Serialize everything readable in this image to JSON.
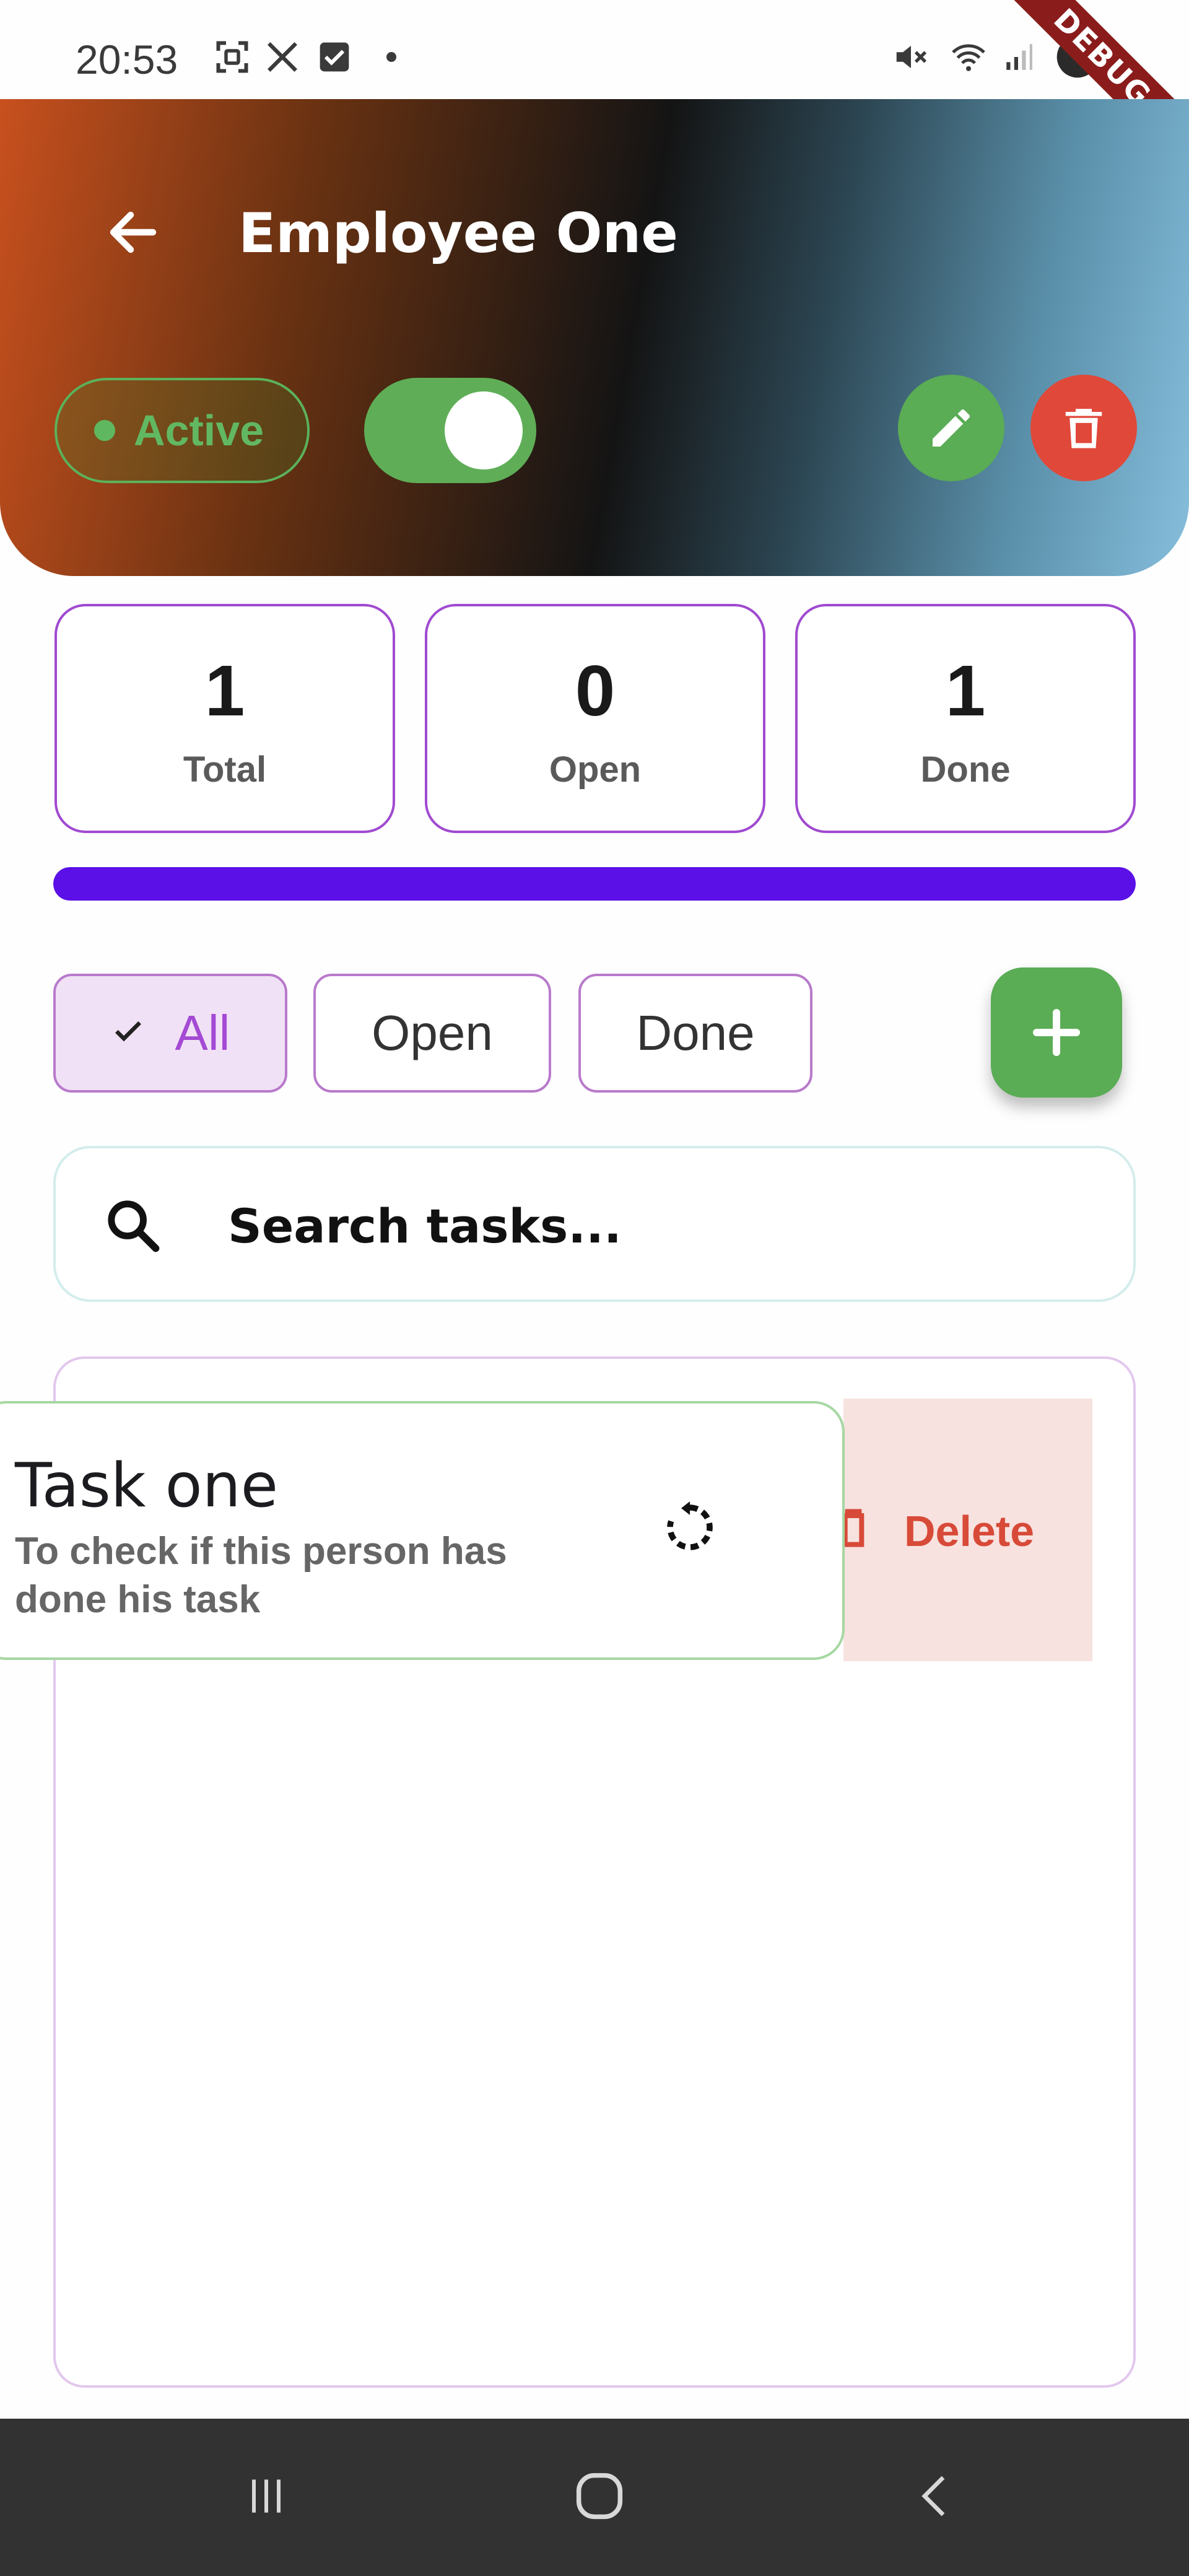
{
  "status_bar": {
    "time": "20:53",
    "debug_banner": "DEBUG"
  },
  "header": {
    "title": "Employee One",
    "status_label": "Active",
    "toggle_on": true,
    "colors": {
      "active": "#5fb85f",
      "edit": "#5aac55",
      "delete": "#e0483a"
    }
  },
  "stats": {
    "total": {
      "value": "1",
      "label": "Total"
    },
    "open": {
      "value": "0",
      "label": "Open"
    },
    "done": {
      "value": "1",
      "label": "Done"
    },
    "progress_fraction": 1.0
  },
  "filters": {
    "all": "All",
    "open": "Open",
    "done": "Done",
    "selected": "All"
  },
  "search": {
    "placeholder": "Search tasks..."
  },
  "tasks": [
    {
      "title": "Task one",
      "description": "To check if this person has done his task",
      "swipe_action_label": "Delete"
    }
  ],
  "icons": {
    "back": "arrow-left-icon",
    "edit": "pencil-icon",
    "delete": "trash-icon",
    "add": "plus-icon",
    "search": "search-icon",
    "restore": "restore-icon"
  }
}
